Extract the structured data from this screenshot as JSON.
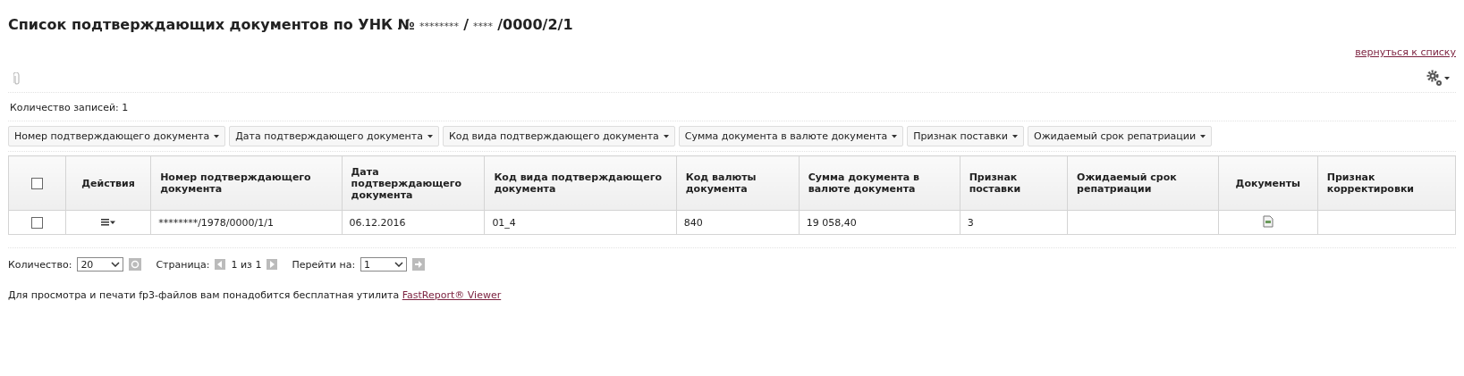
{
  "title": [
    {
      "text": "Список подтверждающих документов по УНК №",
      "bold": true
    },
    {
      "text": "********",
      "bold": false
    },
    {
      "text": "/",
      "bold": true
    },
    {
      "text": "****",
      "bold": false
    },
    {
      "text": "/0000/2/1",
      "bold": true
    }
  ],
  "back_link": "вернуться к списку",
  "record_count": "Количество записей: 1",
  "filters": [
    "Номер подтверждающего документа",
    "Дата подтверждающего документа",
    "Код вида подтверждающего документа",
    "Сумма документа в валюте документа",
    "Признак поставки",
    "Ожидаемый срок репатриации"
  ],
  "table": {
    "select_all_checked": false,
    "columns": [
      {
        "kind": "check"
      },
      {
        "kind": "center",
        "label": "Действия"
      },
      {
        "kind": "text",
        "label": "Номер подтверждающего документа"
      },
      {
        "kind": "text",
        "label": "Дата подтверждающего документа"
      },
      {
        "kind": "text",
        "label": "Код вида подтверждающего документа"
      },
      {
        "kind": "text",
        "label": "Код валюты документа"
      },
      {
        "kind": "text",
        "label": "Сумма документа в валюте документа"
      },
      {
        "kind": "text",
        "label": "Признак поставки"
      },
      {
        "kind": "text",
        "label": "Ожидаемый срок репатриации"
      },
      {
        "kind": "center",
        "label": "Документы"
      },
      {
        "kind": "text",
        "label": "Признак корректировки"
      }
    ],
    "rows": [
      {
        "checked": false,
        "number": "********/1978/0000/1/1",
        "date": "06.12.2016",
        "type_code": "01_4",
        "currency": "840",
        "amount": "19 058,40",
        "delivery": "3",
        "has_document": true
      }
    ]
  },
  "pager": {
    "count_label": "Количество:",
    "count_value": "20",
    "page_label": "Страница:",
    "page_text": "1 из 1",
    "goto_label": "Перейти на:",
    "goto_value": "1"
  },
  "note": {
    "text": "Для просмотра и печати fp3-файлов вам понадобится бесплатная утилита ",
    "link": "FastReport® Viewer"
  }
}
